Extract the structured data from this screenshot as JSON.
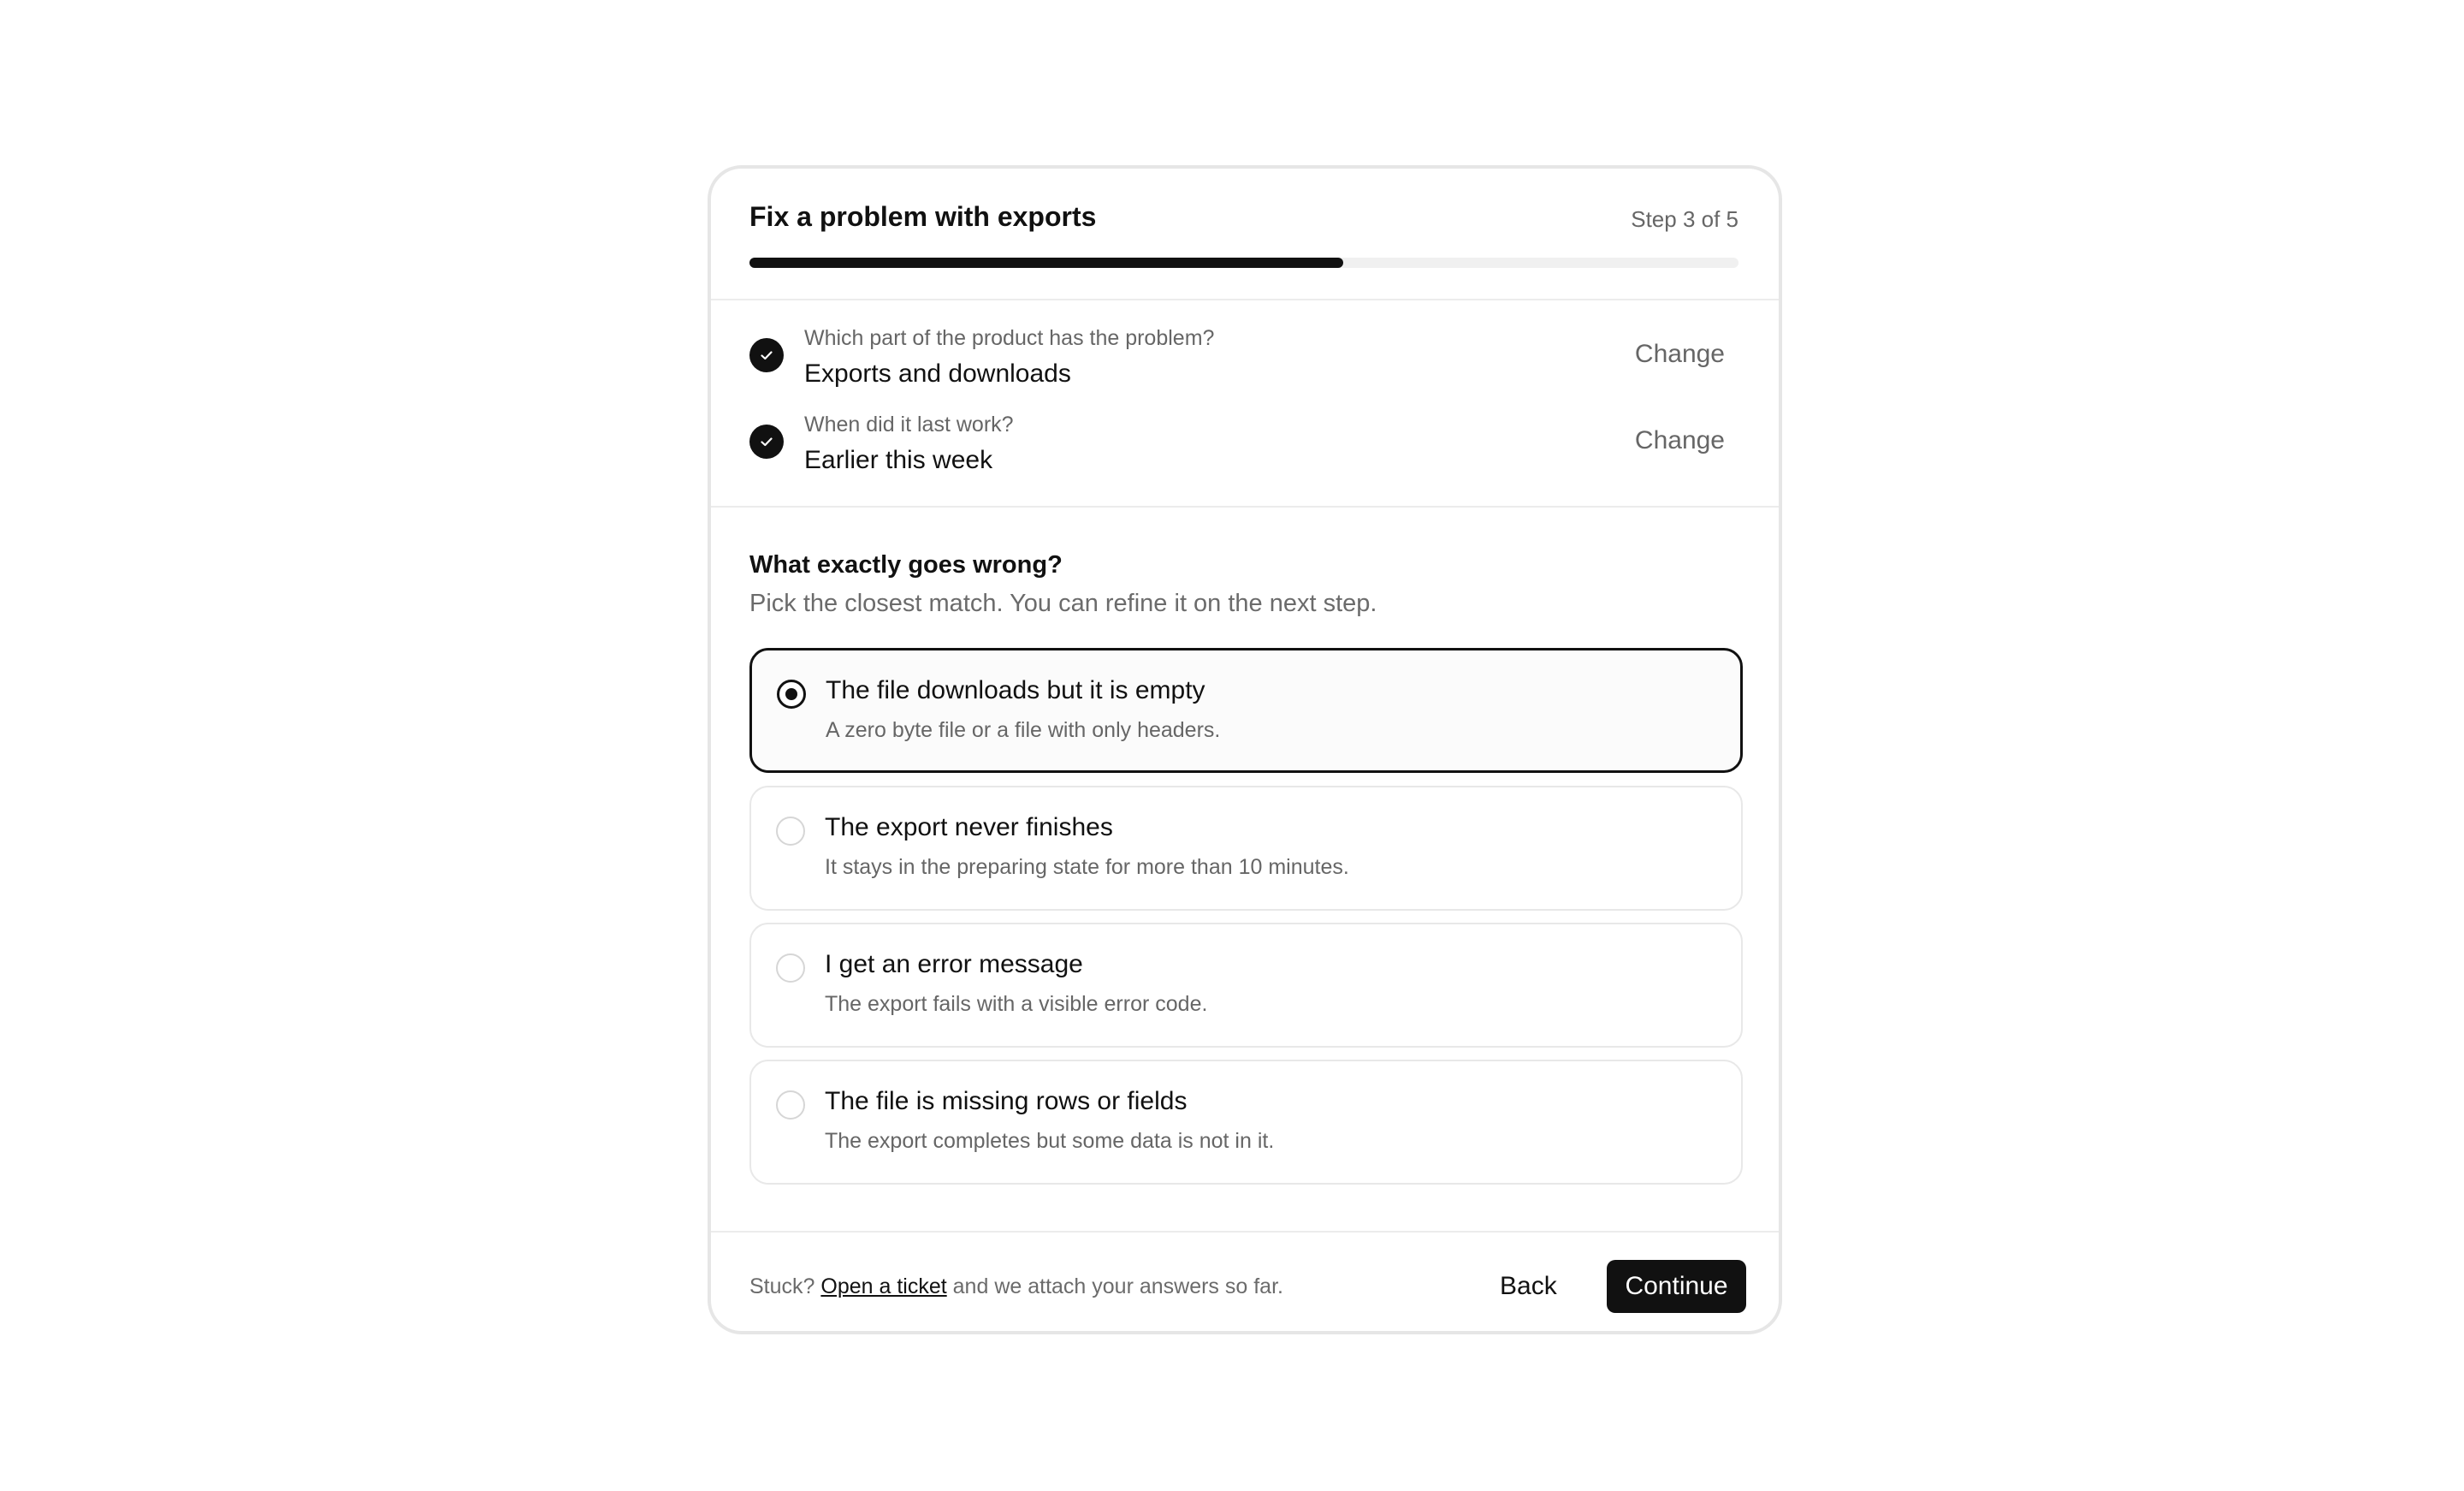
{
  "header": {
    "title": "Fix a problem with exports",
    "step_label": "Step 3 of 5",
    "progress": 0.6
  },
  "answered": [
    {
      "question": "Which part of the product has the problem?",
      "answer": "Exports and downloads",
      "change_label": "Change"
    },
    {
      "question": "When did it last work?",
      "answer": "Earlier this week",
      "change_label": "Change"
    }
  ],
  "current": {
    "question": "What exactly goes wrong?",
    "hint": "Pick the closest match. You can refine it on the next step.",
    "options": [
      {
        "title": "The file downloads but it is empty",
        "description": "A zero byte file or a file with only headers.",
        "selected": true
      },
      {
        "title": "The export never finishes",
        "description": "It stays in the preparing state for more than 10 minutes.",
        "selected": false
      },
      {
        "title": "I get an error message",
        "description": "The export fails with a visible error code.",
        "selected": false
      },
      {
        "title": "The file is missing rows or fields",
        "description": "The export completes but some data is not in it.",
        "selected": false
      }
    ]
  },
  "footer": {
    "stuck_prefix": "Stuck?",
    "ticket_link": "Open a ticket",
    "stuck_suffix": "and we attach your answers so far.",
    "back_label": "Back",
    "continue_label": "Continue"
  },
  "colors": {
    "accent": "#111111",
    "muted_text": "#666666",
    "border": "#e8e8e8"
  }
}
